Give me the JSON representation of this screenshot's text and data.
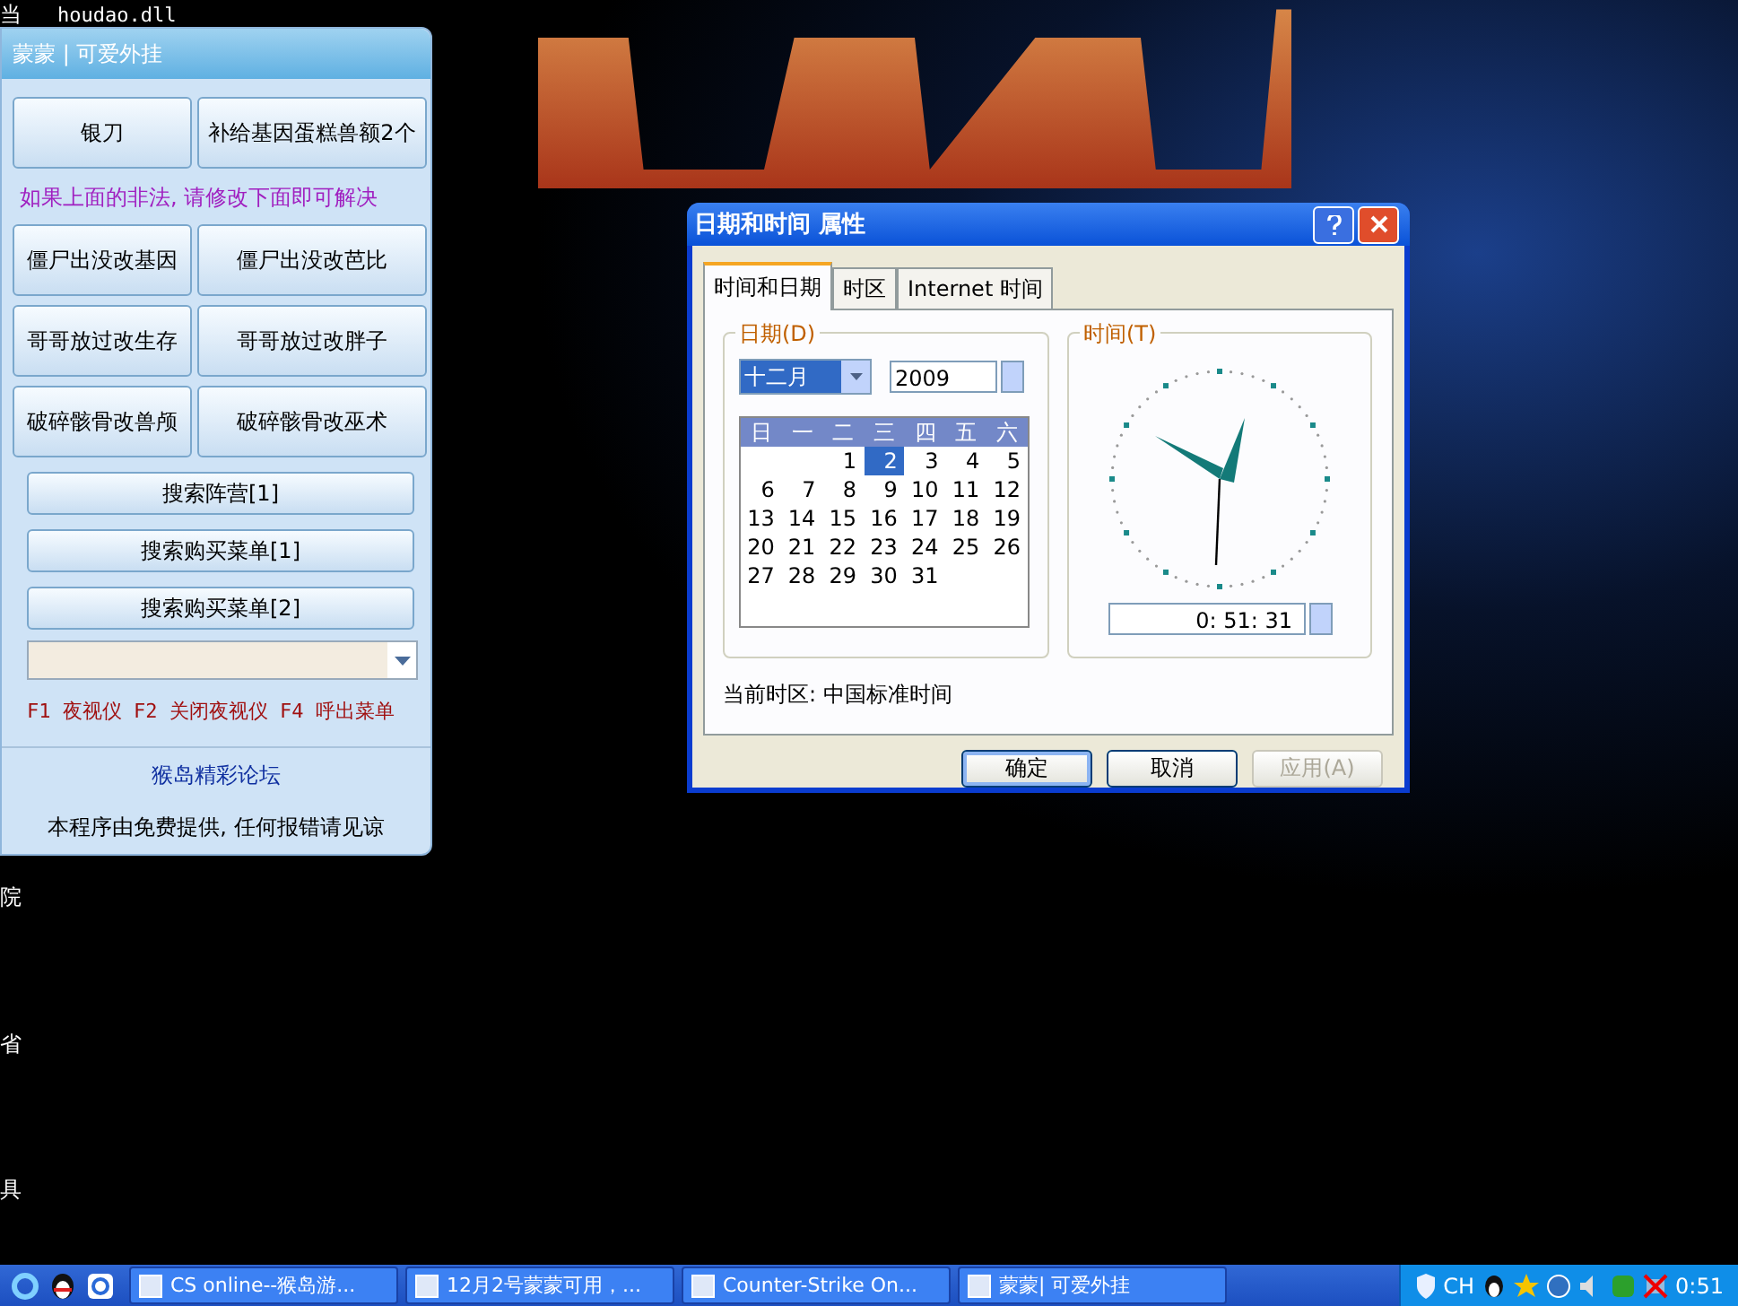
{
  "desktop": {
    "labels": [
      {
        "text": "当"
      },
      {
        "text": "houdao.dll"
      },
      {
        "text": "院"
      },
      {
        "text": "省"
      },
      {
        "text": "具"
      }
    ]
  },
  "panel": {
    "title": "蒙蒙 | 可爱外挂",
    "top_buttons": [
      "银刀",
      "补给基因蛋糕兽额2个"
    ],
    "notice": "如果上面的非法, 请修改下面即可解决",
    "grid_buttons": [
      "僵尸出没改基因",
      "僵尸出没改芭比",
      "哥哥放过改生存",
      "哥哥放过改胖子",
      "破碎骸骨改兽颅",
      "破碎骸骨改巫术"
    ],
    "wide_buttons": [
      "搜索阵营[1]",
      "搜索购买菜单[1]",
      "搜索购买菜单[2]"
    ],
    "hotkeys": "F1 夜视仪 F2 关闭夜视仪 F4 呼出菜单",
    "link": "猴岛精彩论坛",
    "footer": "本程序由免费提供, 任何报错请见谅"
  },
  "dialog": {
    "title": "日期和时间 属性",
    "tabs": [
      {
        "label": "时间和日期",
        "selected": true
      },
      {
        "label": "时区",
        "selected": false
      },
      {
        "label": "Internet 时间",
        "selected": false
      }
    ],
    "date_group": {
      "label": "日期(D)",
      "month": "十二月",
      "year": "2009",
      "weekdays": [
        "日",
        "一",
        "二",
        "三",
        "四",
        "五",
        "六"
      ],
      "days": [
        {
          "kind": "blank"
        },
        {
          "kind": "blank"
        },
        {
          "kind": "day",
          "label": "1",
          "selected": false
        },
        {
          "kind": "day",
          "label": "2",
          "selected": true
        },
        {
          "kind": "day",
          "label": "3",
          "selected": false
        },
        {
          "kind": "day",
          "label": "4",
          "selected": false
        },
        {
          "kind": "day",
          "label": "5",
          "selected": false
        },
        {
          "kind": "day",
          "label": "6",
          "selected": false
        },
        {
          "kind": "day",
          "label": "7",
          "selected": false
        },
        {
          "kind": "day",
          "label": "8",
          "selected": false
        },
        {
          "kind": "day",
          "label": "9",
          "selected": false
        },
        {
          "kind": "day",
          "label": "10",
          "selected": false
        },
        {
          "kind": "day",
          "label": "11",
          "selected": false
        },
        {
          "kind": "day",
          "label": "12",
          "selected": false
        },
        {
          "kind": "day",
          "label": "13",
          "selected": false
        },
        {
          "kind": "day",
          "label": "14",
          "selected": false
        },
        {
          "kind": "day",
          "label": "15",
          "selected": false
        },
        {
          "kind": "day",
          "label": "16",
          "selected": false
        },
        {
          "kind": "day",
          "label": "17",
          "selected": false
        },
        {
          "kind": "day",
          "label": "18",
          "selected": false
        },
        {
          "kind": "day",
          "label": "19",
          "selected": false
        },
        {
          "kind": "day",
          "label": "20",
          "selected": false
        },
        {
          "kind": "day",
          "label": "21",
          "selected": false
        },
        {
          "kind": "day",
          "label": "22",
          "selected": false
        },
        {
          "kind": "day",
          "label": "23",
          "selected": false
        },
        {
          "kind": "day",
          "label": "24",
          "selected": false
        },
        {
          "kind": "day",
          "label": "25",
          "selected": false
        },
        {
          "kind": "day",
          "label": "26",
          "selected": false
        },
        {
          "kind": "day",
          "label": "27",
          "selected": false
        },
        {
          "kind": "day",
          "label": "28",
          "selected": false
        },
        {
          "kind": "day",
          "label": "29",
          "selected": false
        },
        {
          "kind": "day",
          "label": "30",
          "selected": false
        },
        {
          "kind": "day",
          "label": "31",
          "selected": false
        }
      ]
    },
    "time_group": {
      "label": "时间(T)",
      "time": "0: 51: 31"
    },
    "timezone": "当前时区: 中国标准时间",
    "buttons": [
      {
        "label": "确定",
        "default": true,
        "disabled": false
      },
      {
        "label": "取消",
        "default": false,
        "disabled": false
      },
      {
        "label": "应用(A)",
        "default": false,
        "disabled": true
      }
    ]
  },
  "taskbar": {
    "tasks": [
      {
        "label": "CS online--猴岛游...",
        "selected": false
      },
      {
        "label": "12月2号蒙蒙可用，...",
        "selected": false
      },
      {
        "label": "Counter-Strike On...",
        "selected": false
      },
      {
        "label": "蒙蒙| 可爱外挂",
        "selected": false
      }
    ],
    "language": "CH",
    "clock": "0:51"
  }
}
